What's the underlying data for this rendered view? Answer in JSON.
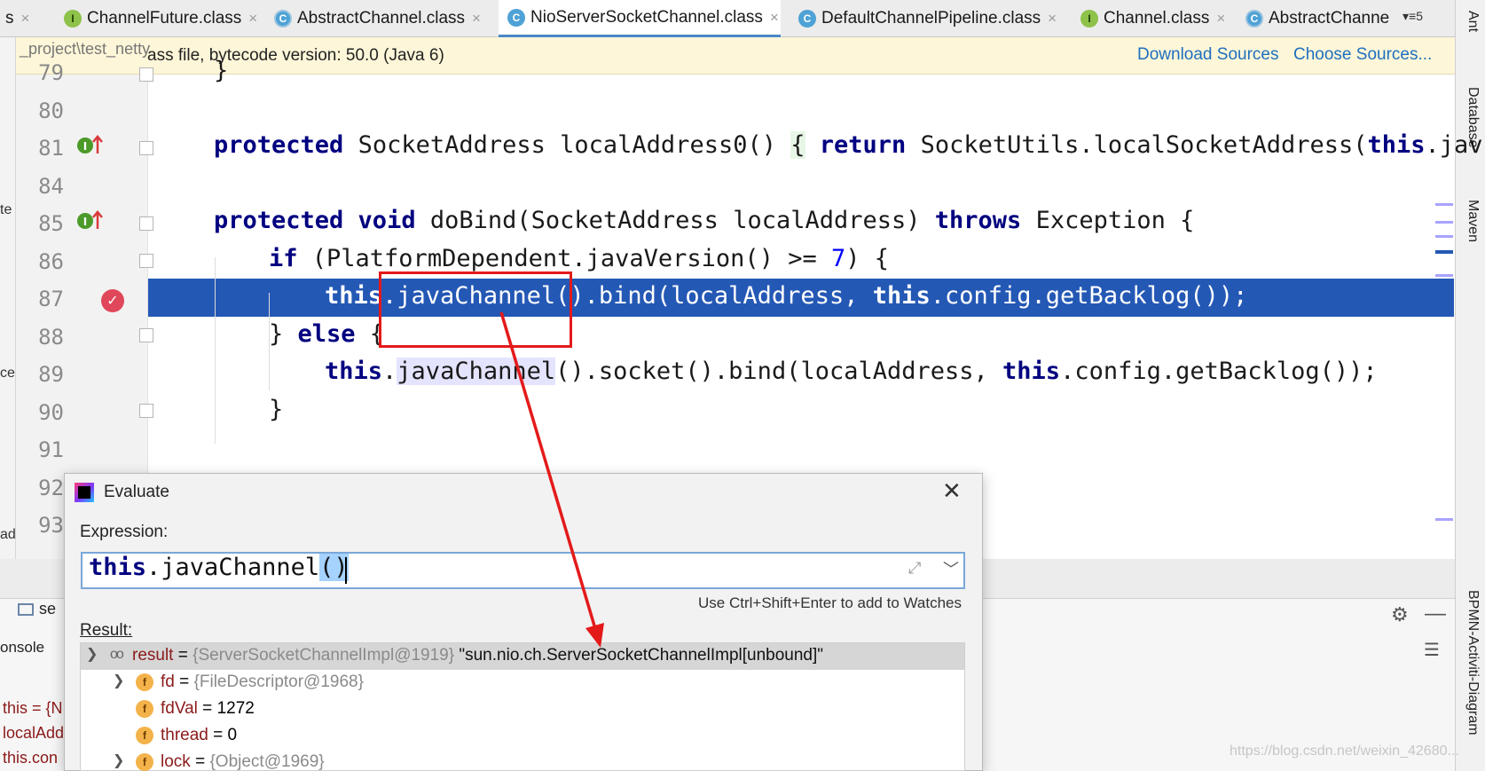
{
  "tabs": [
    {
      "label": "s",
      "icon": ""
    },
    {
      "label": "ChannelFuture.class",
      "icon": "I"
    },
    {
      "label": "AbstractChannel.class",
      "icon": "C"
    },
    {
      "label": "NioServerSocketChannel.class",
      "icon": "C"
    },
    {
      "label": "DefaultChannelPipeline.class",
      "icon": "C"
    },
    {
      "label": "Channel.class",
      "icon": "I"
    },
    {
      "label": "AbstractChanne",
      "icon": "C"
    }
  ],
  "tab_close": "×",
  "tab_overflow": "▾≡5",
  "banner": {
    "project_path": "_project\\test_netty",
    "text": "ass file, bytecode version: 50.0 (Java 6)",
    "download_sources": "Download Sources",
    "choose_sources": "Choose Sources..."
  },
  "right_tools": {
    "ant": "Ant",
    "database": "Database",
    "maven": "Maven",
    "bpmn": "BPMN-Activiti-Diagram"
  },
  "left_strip": {
    "a": "te",
    "b": "ces",
    "c": "ad"
  },
  "editor": {
    "line_numbers": [
      "79",
      "80",
      "81",
      "84",
      "85",
      "86",
      "87",
      "88",
      "89",
      "90",
      "91",
      "92",
      "93"
    ],
    "code": {
      "l79": "}",
      "l81_kw": "protected",
      "l81_a": " SocketAddress localAddress0() ",
      "l81_brace": "{",
      "l81_b": " ",
      "l81_kw2": "return",
      "l81_c": " SocketUtils.localSocketAddress(",
      "l81_kw3": "this",
      "l81_d": ".jav",
      "l85_kw": "protected void",
      "l85_a": " doBind(SocketAddress localAddress) ",
      "l85_kw2": "throws",
      "l85_b": " Exception {",
      "l86_kw": "if",
      "l86_a": " (PlatformDependent.javaVersion() >= ",
      "l86_num": "7",
      "l86_b": ") {",
      "l87_kw": "this",
      "l87_a": ".javaChannel().bind(localAddress, ",
      "l87_kw2": "this",
      "l87_b": ".config.getBacklog());",
      "l88_a": "} ",
      "l88_kw": "else",
      "l88_b": " {",
      "l89_kw": "this",
      "l89_a": ".",
      "l89_usage": "javaChannel",
      "l89_b": "().socket().bind(localAddress, ",
      "l89_kw2": "this",
      "l89_c": ".config.getBacklog());",
      "l90": "}"
    }
  },
  "debug": {
    "tab_label": "se",
    "console_label": "onsole",
    "vars": [
      "this = {N",
      "localAdd",
      "this.con"
    ]
  },
  "evaluate": {
    "title": "Evaluate",
    "close": "✕",
    "expression_label": "Expression:",
    "expression_kw": "this",
    "expression_rest": ".javaChannel",
    "expression_sel": "()",
    "hint": "Use Ctrl+Shift+Enter to add to Watches",
    "result_label": "Result:",
    "rows": [
      {
        "name": "result",
        "eq": " = ",
        "type": "{ServerSocketChannelImpl@1919}",
        "value": " \"sun.nio.ch.ServerSocketChannelImpl[unbound]\""
      },
      {
        "name": "fd",
        "eq": " = ",
        "type": "{FileDescriptor@1968}",
        "value": ""
      },
      {
        "name": "fdVal",
        "eq": " = ",
        "type": "",
        "value": "1272"
      },
      {
        "name": "thread",
        "eq": " = ",
        "type": "",
        "value": "0"
      },
      {
        "name": "lock",
        "eq": " = ",
        "type": "{Object@1969}",
        "value": ""
      }
    ]
  },
  "watermark": "https://blog.csdn.net/weixin_42680...",
  "colors": {
    "accent": "#4a88c7",
    "selection": "#2458b5",
    "keyword": "#000080",
    "annotation_red": "#e41a1a",
    "link": "#1f6fbf"
  }
}
